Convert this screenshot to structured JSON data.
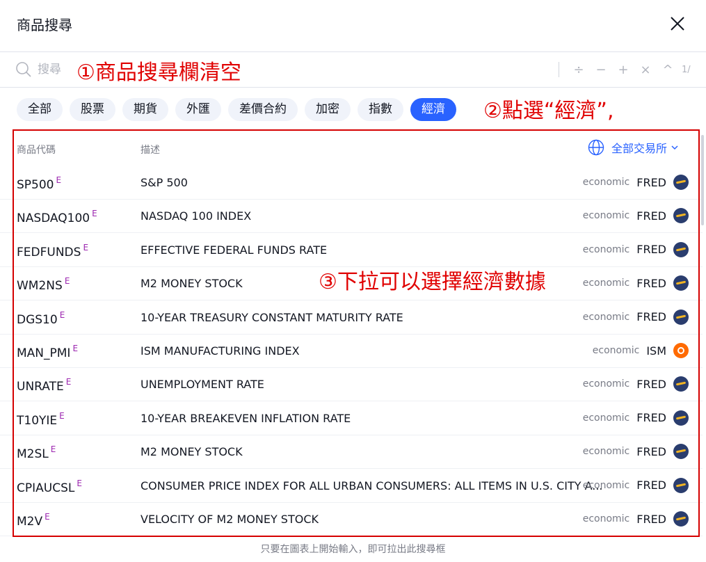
{
  "header": {
    "title": "商品搜尋"
  },
  "search": {
    "placeholder": "搜尋",
    "page": "1/"
  },
  "annotations": {
    "step1": "①商品搜尋欄清空",
    "step2": "②點選“經濟”,",
    "step3": "③下拉可以選擇經濟數據"
  },
  "filters": [
    "全部",
    "股票",
    "期貨",
    "外匯",
    "差價合約",
    "加密",
    "指數",
    "經濟"
  ],
  "active_filter": "經濟",
  "list": {
    "col_symbol": "商品代碼",
    "col_description": "描述",
    "exchange_filter": "全部交易所",
    "rows": [
      {
        "symbol": "SP500",
        "badge": "E",
        "description": "S&P 500",
        "type": "economic",
        "source": "FRED",
        "logo": "fred"
      },
      {
        "symbol": "NASDAQ100",
        "badge": "E",
        "description": "NASDAQ 100 INDEX",
        "type": "economic",
        "source": "FRED",
        "logo": "fred"
      },
      {
        "symbol": "FEDFUNDS",
        "badge": "E",
        "description": "EFFECTIVE FEDERAL FUNDS RATE",
        "type": "economic",
        "source": "FRED",
        "logo": "fred"
      },
      {
        "symbol": "WM2NS",
        "badge": "E",
        "description": "M2 MONEY STOCK",
        "type": "economic",
        "source": "FRED",
        "logo": "fred"
      },
      {
        "symbol": "DGS10",
        "badge": "E",
        "description": "10-YEAR TREASURY CONSTANT MATURITY RATE",
        "type": "economic",
        "source": "FRED",
        "logo": "fred"
      },
      {
        "symbol": "MAN_PMI",
        "badge": "E",
        "description": "ISM MANUFACTURING INDEX",
        "type": "economic",
        "source": "ISM",
        "logo": "ism"
      },
      {
        "symbol": "UNRATE",
        "badge": "E",
        "description": "UNEMPLOYMENT RATE",
        "type": "economic",
        "source": "FRED",
        "logo": "fred"
      },
      {
        "symbol": "T10YIE",
        "badge": "E",
        "description": "10-YEAR BREAKEVEN INFLATION RATE",
        "type": "economic",
        "source": "FRED",
        "logo": "fred"
      },
      {
        "symbol": "M2SL",
        "badge": "E",
        "description": "M2 MONEY STOCK",
        "type": "economic",
        "source": "FRED",
        "logo": "fred"
      },
      {
        "symbol": "CPIAUCSL",
        "badge": "E",
        "description": "CONSUMER PRICE INDEX FOR ALL URBAN CONSUMERS: ALL ITEMS IN U.S. CITY A...",
        "type": "economic",
        "source": "FRED",
        "logo": "fred"
      },
      {
        "symbol": "M2V",
        "badge": "E",
        "description": "VELOCITY OF M2 MONEY STOCK",
        "type": "economic",
        "source": "FRED",
        "logo": "fred"
      }
    ]
  },
  "footer": {
    "hint": "只要在圖表上開始輸入，即可拉出此搜尋框"
  },
  "colors": {
    "accent": "#2962ff",
    "annotation": "#e00000",
    "badge": "#9c27b0"
  }
}
